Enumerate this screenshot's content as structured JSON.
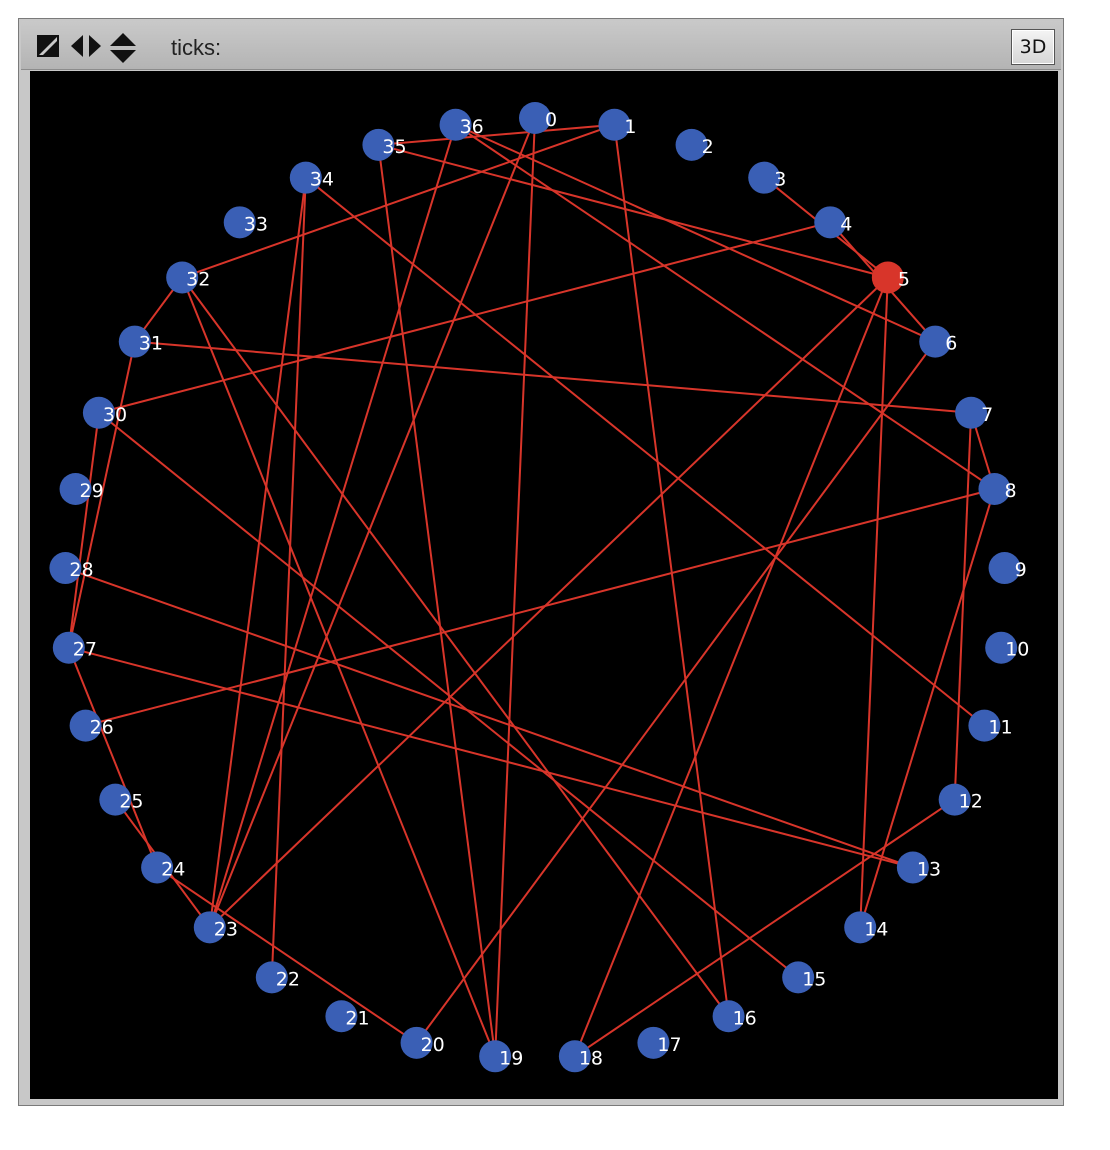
{
  "toolbar": {
    "ticks_label": "ticks:",
    "button_3d": "3D",
    "icons": [
      "settings-edit-icon",
      "horizontal-arrows-icon",
      "vertical-arrows-icon"
    ]
  },
  "colors": {
    "background": "#000000",
    "node": "#3a5fb5",
    "highlight_node": "#d8352a",
    "edge": "#d8352a"
  },
  "network": {
    "node_count": 37,
    "highlighted_node": "5",
    "nodes": [
      "0",
      "1",
      "2",
      "3",
      "4",
      "5",
      "6",
      "7",
      "8",
      "9",
      "10",
      "11",
      "12",
      "13",
      "14",
      "15",
      "16",
      "17",
      "18",
      "19",
      "20",
      "21",
      "22",
      "23",
      "24",
      "25",
      "26",
      "27",
      "28",
      "29",
      "30",
      "31",
      "32",
      "33",
      "34",
      "35",
      "36"
    ],
    "edges": [
      [
        36,
        6
      ],
      [
        35,
        1
      ],
      [
        35,
        5
      ],
      [
        36,
        8
      ],
      [
        3,
        5
      ],
      [
        4,
        6
      ],
      [
        4,
        30
      ],
      [
        5,
        14
      ],
      [
        5,
        18
      ],
      [
        5,
        23
      ],
      [
        6,
        20
      ],
      [
        7,
        31
      ],
      [
        7,
        8
      ],
      [
        7,
        12
      ],
      [
        8,
        26
      ],
      [
        8,
        14
      ],
      [
        1,
        16
      ],
      [
        0,
        19
      ],
      [
        0,
        23
      ],
      [
        36,
        23
      ],
      [
        35,
        19
      ],
      [
        34,
        11
      ],
      [
        34,
        22
      ],
      [
        34,
        23
      ],
      [
        32,
        31
      ],
      [
        32,
        19
      ],
      [
        32,
        16
      ],
      [
        31,
        27
      ],
      [
        30,
        27
      ],
      [
        30,
        15
      ],
      [
        28,
        13
      ],
      [
        27,
        13
      ],
      [
        27,
        24
      ],
      [
        24,
        20
      ],
      [
        25,
        23
      ],
      [
        12,
        18
      ],
      [
        1,
        32
      ]
    ]
  }
}
